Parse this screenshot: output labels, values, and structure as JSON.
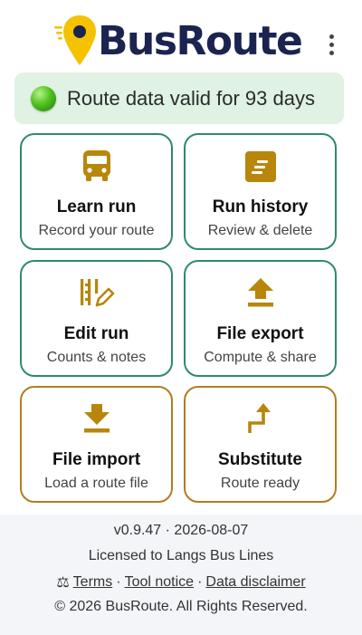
{
  "app": {
    "name": "BusRoute"
  },
  "colors": {
    "navy": "#1b2450",
    "gold": "#b8860b",
    "green_border": "#2e8b68",
    "brown_border": "#b07d1f",
    "status_bg": "#dff2e3"
  },
  "header": {
    "logo_text": "BusRoute",
    "menu_icon": "more-vertical-icon"
  },
  "status": {
    "text": "Route data valid for 93 days",
    "icon": "green-status-dot-icon"
  },
  "tiles": [
    {
      "title": "Learn run",
      "subtitle": "Record your route",
      "icon": "bus-icon"
    },
    {
      "title": "Run history",
      "subtitle": "Review & delete",
      "icon": "history-list-icon"
    },
    {
      "title": "Edit run",
      "subtitle": "Counts & notes",
      "icon": "edit-tally-icon"
    },
    {
      "title": "File export",
      "subtitle": "Compute & share",
      "icon": "upload-icon"
    },
    {
      "title": "File import",
      "subtitle": "Load a route file",
      "icon": "download-icon"
    },
    {
      "title": "Substitute",
      "subtitle": "Route ready",
      "icon": "turn-up-right-icon"
    }
  ],
  "footer": {
    "version": "v0.9.47 · 2026-08-07",
    "license": "Licensed to Langs Bus Lines",
    "scale_icon": "⚖",
    "links": [
      "Terms",
      "Tool notice",
      "Data disclaimer"
    ],
    "link_separator": "·",
    "copyright": "© 2026 BusRoute. All Rights Reserved."
  }
}
